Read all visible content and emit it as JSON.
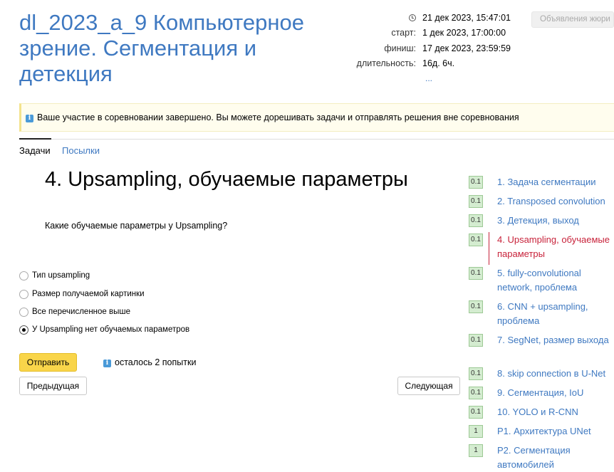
{
  "contest": {
    "title": "dl_2023_a_9 Компьютерное зрение. Сегментация и детекция"
  },
  "meta": {
    "current_time": "21 дек 2023, 15:47:01",
    "start_label": "старт:",
    "start_value": "1 дек 2023, 17:00:00",
    "finish_label": "финиш:",
    "finish_value": "17 дек 2023, 23:59:59",
    "duration_label": "длительность:",
    "duration_value": "16д. 6ч.",
    "more": "..."
  },
  "jury_button": "Объявления жюри",
  "notice": "Ваше участие в соревновании завершено. Вы можете дорешивать задачи и отправлять решения вне соревнования",
  "tabs": [
    {
      "label": "Задачи",
      "active": true
    },
    {
      "label": "Посылки",
      "active": false
    }
  ],
  "task": {
    "title": "4. Upsampling, обучаемые параметры",
    "question": "Какие обучаемые параметры у Upsampling?",
    "options": [
      {
        "label": "Тип upsampling",
        "checked": false
      },
      {
        "label": "Размер получаемой картинки",
        "checked": false
      },
      {
        "label": "Все перечисленное выше",
        "checked": false
      },
      {
        "label": "У Upsampling нет обучаемых параметров",
        "checked": true
      }
    ],
    "submit_label": "Отправить",
    "attempts": "осталось 2 попытки",
    "prev_label": "Предыдущая",
    "next_label": "Следующая"
  },
  "problems": [
    {
      "score": "0.1",
      "label": "1. Задача сегментации"
    },
    {
      "score": "0.1",
      "label": "2. Transposed convolution"
    },
    {
      "score": "0.1",
      "label": "3. Детекция, выход"
    },
    {
      "score": "0.1",
      "label": "4. Upsampling, обучаемые параметры",
      "current": true
    },
    {
      "score": "0.1",
      "label": "5. fully-convolutional network, проблема"
    },
    {
      "score": "0.1",
      "label": "6. CNN + upsampling, проблема"
    },
    {
      "score": "0.1",
      "label": "7. SegNet, размер выхода"
    },
    {
      "score": "0.1",
      "label": "8. skip connection в U-Net"
    },
    {
      "score": "0.1",
      "label": "9. Сегментация, IoU"
    },
    {
      "score": "0.1",
      "label": "10. YOLO и R-CNN"
    },
    {
      "score": "1",
      "label": "P1. Архитектура UNet"
    },
    {
      "score": "1",
      "label": "P2. Сегментация автомобилей"
    }
  ],
  "colors": {
    "link": "#3f79c1",
    "current": "#c8233b",
    "submit": "#f9d54a",
    "badge": "#d4ecd0"
  }
}
